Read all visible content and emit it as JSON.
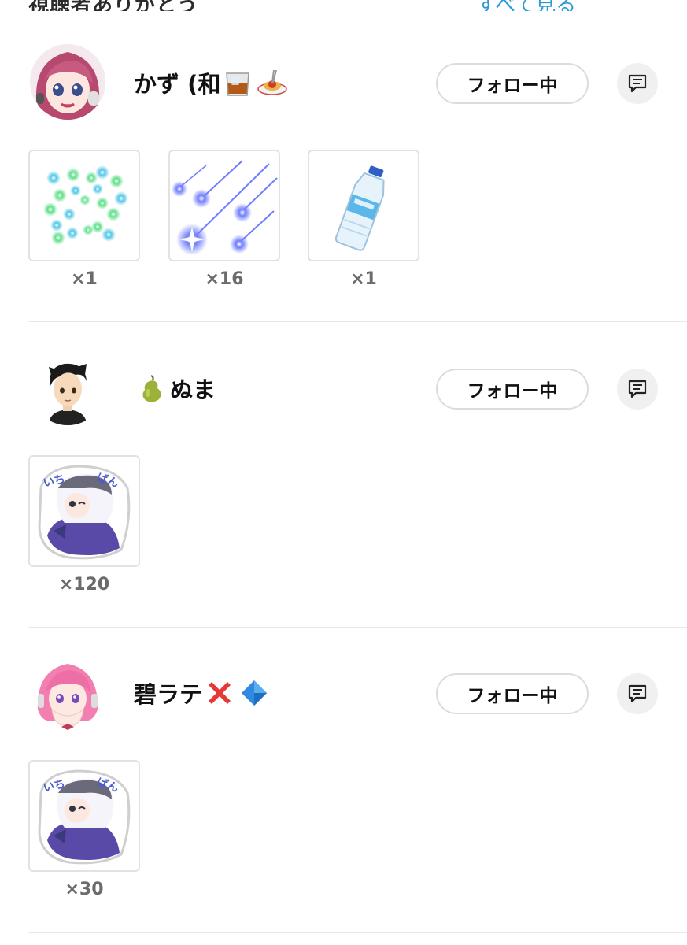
{
  "top": {
    "left_text": "視聴者ありがとう",
    "right_text": "すべて見る"
  },
  "colors": {
    "follow_border": "#dcdcdc",
    "msg_bg": "#f0f0f0",
    "count_text": "#6b6b6b",
    "divider": "#e8e8e8"
  },
  "users": [
    {
      "name": "かず (和",
      "name_emojis_after": [
        "whisky-glass-emoji",
        "spaghetti-emoji"
      ],
      "follow_label": "フォロー中",
      "message_icon": "message-icon",
      "gifts": [
        {
          "icon": "green-sparkle-circle-gift-icon",
          "count": "×1"
        },
        {
          "icon": "blue-shooting-stars-gift-icon",
          "count": "×16"
        },
        {
          "icon": "water-bottle-gift-icon",
          "count": "×1"
        }
      ]
    },
    {
      "name": "ぬま",
      "name_emojis_before": [
        "pear-emoji"
      ],
      "follow_label": "フォロー中",
      "message_icon": "message-icon",
      "gifts": [
        {
          "icon": "ichiban-chibi-sticker-gift-icon",
          "count": "×120"
        }
      ]
    },
    {
      "name": "碧ラテ",
      "name_emojis_after": [
        "red-cross-emoji",
        "blue-diamond-emoji"
      ],
      "follow_label": "フォロー中",
      "message_icon": "message-icon",
      "gifts": [
        {
          "icon": "ichiban-chibi-sticker-gift-icon",
          "count": "×30"
        }
      ]
    }
  ]
}
